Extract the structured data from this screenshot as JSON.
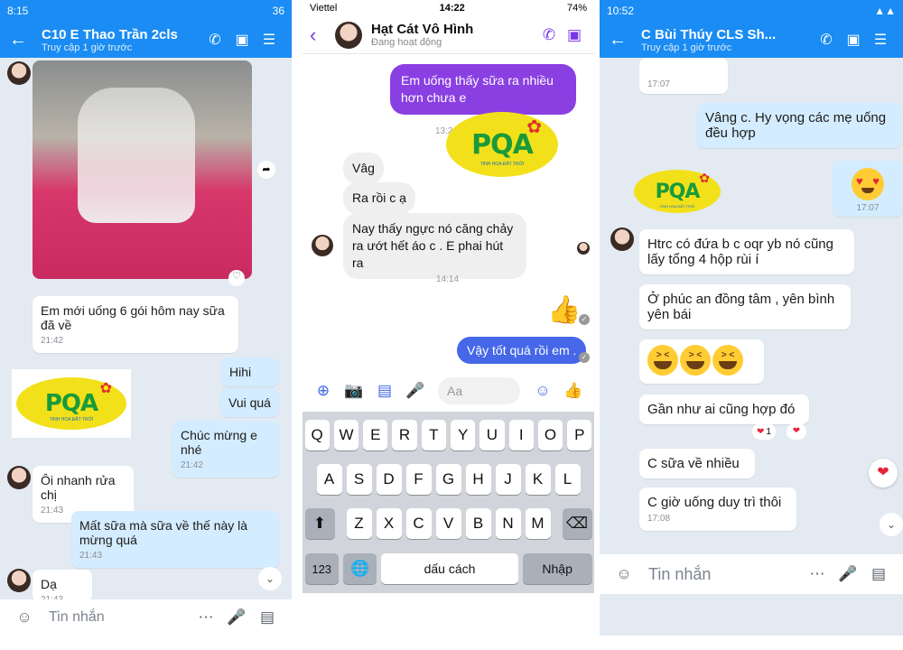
{
  "left": {
    "status_time": "8:15",
    "status_right": "36",
    "title": "C10 E Thao Trần 2cls",
    "subtitle": "Truy cập 1 giờ trước",
    "messages": [
      {
        "text": "Em mới uống 6 gói hôm nay sữa đã về",
        "time": "21:42"
      },
      {
        "text": "Hihi"
      },
      {
        "text": "Vui quá"
      },
      {
        "text": "Chúc mừng e nhé",
        "time": "21:42"
      },
      {
        "text": "Ôi nhanh rửa chị",
        "time": "21:43"
      },
      {
        "text": "Mất sữa mà sữa về thế này là mừng quá",
        "time": "21:43"
      },
      {
        "text": "Dạ",
        "time": "21:43"
      }
    ],
    "input_placeholder": "Tin nhắn"
  },
  "middle": {
    "carrier": "Viettel",
    "status_time": "14:22",
    "battery": "74%",
    "title": "Hạt Cát Vô Hình",
    "subtitle": "Đang hoạt động",
    "messages": [
      {
        "text": "Em uống thấy sữa ra nhiều hơn chưa e"
      },
      {
        "text": "Vâg"
      },
      {
        "text": "Ra rồi c ạ"
      },
      {
        "text": "Nay thấy ngực nó căng chảy ra ướt hết  áo c . E phai hút ra"
      },
      {
        "text": "Vậy tốt quá rồi em ."
      }
    ],
    "time_partial": "13:2",
    "time_sep": "14:14",
    "input_placeholder": "Aa",
    "keyboard": {
      "row1": [
        "Q",
        "W",
        "E",
        "R",
        "T",
        "Y",
        "U",
        "I",
        "O",
        "P"
      ],
      "row2": [
        "A",
        "S",
        "D",
        "F",
        "G",
        "H",
        "J",
        "K",
        "L"
      ],
      "row3": [
        "Z",
        "X",
        "C",
        "V",
        "B",
        "N",
        "M"
      ],
      "num_key": "123",
      "space_key": "dấu cách",
      "enter_key": "Nhập"
    }
  },
  "right": {
    "status_time": "10:52",
    "title": "C Bùi Thúy CLS Sh...",
    "subtitle": "Truy cập 1 giờ trước",
    "messages": [
      {
        "time": "17:07"
      },
      {
        "text": "Vâng c. Hy vọng các mẹ uống đều hợp"
      },
      {
        "time": "17:07"
      },
      {
        "text": "Htrc có đứa b c oqr yb nó cũng lấy tổng 4 hộp rùi í"
      },
      {
        "text": "Ở phúc an đồng tâm , yên bình yên bái"
      },
      {
        "text": "Gần như ai cũng hợp đó"
      },
      {
        "text": "C sữa về nhiều"
      },
      {
        "text": "C giờ uống duy trì thôi",
        "time": "17:08"
      }
    ],
    "reaction_count": "1",
    "input_placeholder": "Tin nhắn"
  },
  "logo": {
    "word": "PQA",
    "tagline": "TINH HOA ĐẤT TRỜI"
  },
  "colors": {
    "zalo_blue": "#1a8cf3",
    "messenger_purple": "#8a3fe3",
    "messenger_blue": "#4567e8"
  }
}
